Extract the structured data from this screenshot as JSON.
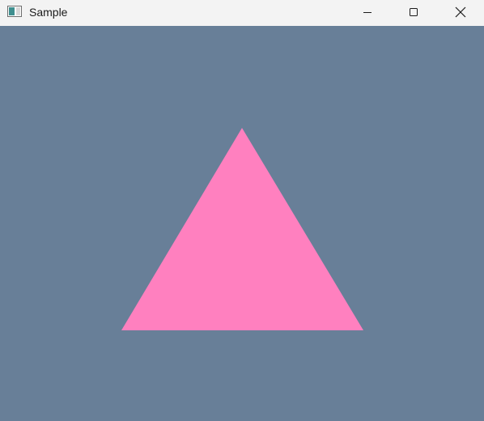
{
  "window": {
    "title": "Sample",
    "app_icon": "window-app-icon",
    "controls": {
      "minimize_icon": "minimize-icon",
      "maximize_icon": "maximize-icon",
      "close_icon": "close-icon"
    }
  },
  "scene": {
    "background_color": "#687f98",
    "shape": "triangle",
    "triangle_color": "#ff80bf",
    "titlebar_color": "#f3f3f3"
  }
}
